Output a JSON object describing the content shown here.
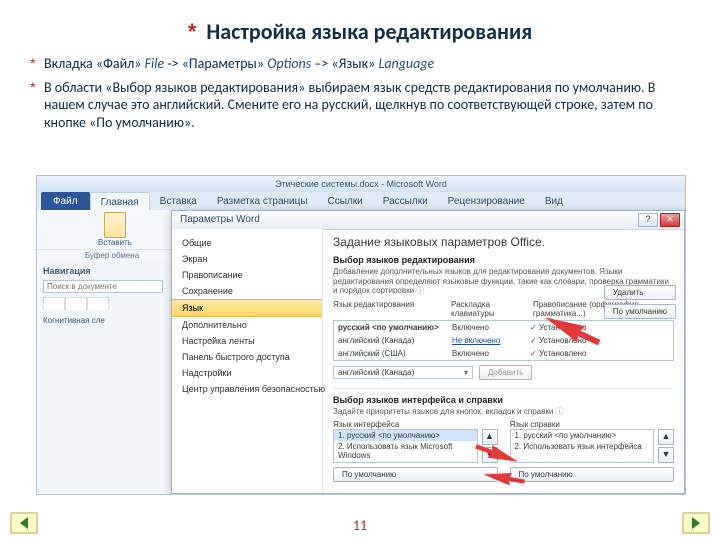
{
  "slide": {
    "title": "Настройка языка редактирования",
    "bullet1": {
      "p1": "Вкладка «Файл» ",
      "i1": "File",
      "p2": " -> «Параметры» ",
      "i2": "Options",
      "p3": " –> «Язык» ",
      "i3": "Language"
    },
    "bullet2": "В области «Выбор языков редактирования» выбираем язык средств редактирования по умолчанию. В нашем случае это английский. Смените его на русский, щелкнув по соответствующей строке, затем по кнопке «По умолчанию».",
    "page": "11"
  },
  "word": {
    "title": "Этические системы.docx - Microsoft Word",
    "ribbon": {
      "file": "Файл",
      "tabs": [
        "Главная",
        "Вставка",
        "Разметка страницы",
        "Ссылки",
        "Рассылки",
        "Рецензирование",
        "Вид"
      ],
      "paste": "Вставить",
      "clipboard_group": "Буфер обмена"
    },
    "nav": {
      "title": "Навигация",
      "search_ph": "Поиск в документе",
      "item": "Когнитивная сле"
    }
  },
  "dialog": {
    "title": "Параметры Word",
    "cats": [
      "Общие",
      "Экран",
      "Правописание",
      "Сохранение",
      "Язык",
      "Дополнительно",
      "Настройка ленты",
      "Панель быстрого доступа",
      "Надстройки",
      "Центр управления безопасностью"
    ],
    "heading": "Задание языковых параметров Office.",
    "editing_section": "Выбор языков редактирования",
    "editing_hint": "Добавление дополнительных языков для редактирования документов. Языки редактирования определяют языковые функции, такие как словари, проверка грамматики и порядок сортировки",
    "cols": {
      "lang": "Язык редактирования",
      "kb": "Раскладка клавиатуры",
      "proof": "Правописание (орфография, грамматика...)"
    },
    "rows": [
      {
        "name": "русский <по умолчанию>",
        "kb": "Включено",
        "proof": "Установлено",
        "bold": true
      },
      {
        "name": "английский (Канада)",
        "kb": "Не включено",
        "proof": "Установлено"
      },
      {
        "name": "английский (США)",
        "kb": "Включено",
        "proof": "Установлено"
      }
    ],
    "add_combo": "английский (Канада)",
    "add_btn": "Добавить",
    "remove_btn": "Удалить",
    "default_btn": "По умолчанию",
    "ui_section": "Выбор языков интерфейса и справки",
    "ui_hint": "Задайте приоритеты языков для кнопок, вкладок и справки",
    "ui_lang_label": "Язык интерфейса",
    "help_lang_label": "Язык справки",
    "ui_list": [
      "1.  русский <по умолчанию>",
      "2.  Использовать язык Microsoft Windows"
    ],
    "help_list": [
      "1.  русский <по умолчанию>",
      "2.  Использовать язык интерфейса"
    ]
  }
}
